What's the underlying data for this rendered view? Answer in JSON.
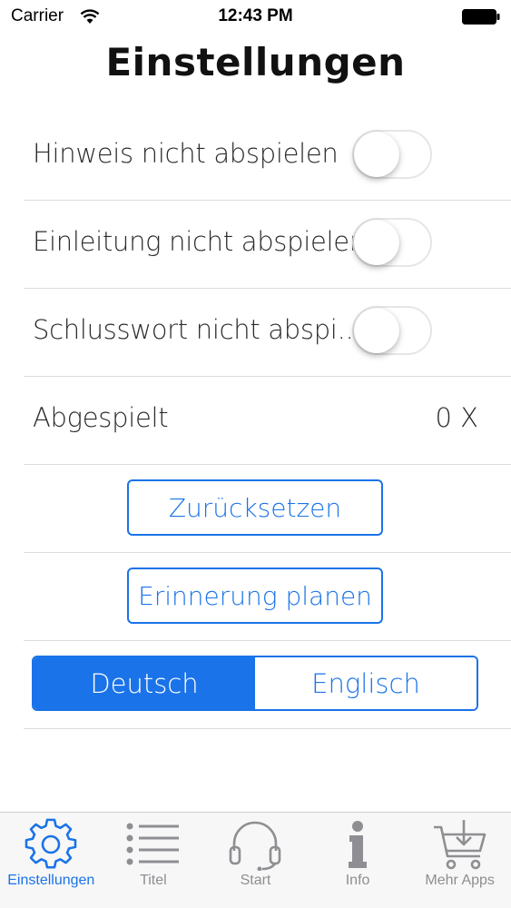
{
  "status_bar": {
    "carrier": "Carrier",
    "time": "12:43 PM"
  },
  "title": "Einstellungen",
  "settings": [
    {
      "label": "Hinweis nicht abspielen",
      "enabled": false
    },
    {
      "label": "Einleitung nicht abspielen",
      "enabled": false
    },
    {
      "label": "Schlusswort nicht abspi...",
      "enabled": false
    }
  ],
  "played": {
    "label": "Abgespielt",
    "value": "0 X"
  },
  "buttons": {
    "reset": "Zurücksetzen",
    "reminder": "Erinnerung planen"
  },
  "language": {
    "options": [
      "Deutsch",
      "Englisch"
    ],
    "selected": "Deutsch"
  },
  "tabs": [
    {
      "label": "Einstellungen",
      "icon": "gear-icon",
      "active": true
    },
    {
      "label": "Titel",
      "icon": "list-icon",
      "active": false
    },
    {
      "label": "Start",
      "icon": "headphones-icon",
      "active": false
    },
    {
      "label": "Info",
      "icon": "info-icon",
      "active": false
    },
    {
      "label": "Mehr Apps",
      "icon": "cart-icon",
      "active": false
    }
  ],
  "colors": {
    "accent": "#1a73e8",
    "inactive": "#8e8e93"
  }
}
